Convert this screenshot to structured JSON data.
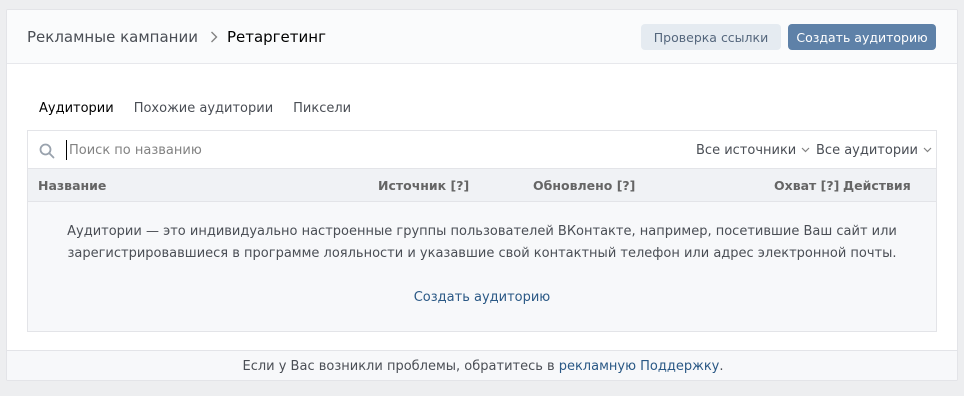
{
  "header": {
    "breadcrumb_root": "Рекламные кампании",
    "breadcrumb_current": "Ретаргетинг",
    "check_link_label": "Проверка ссылки",
    "create_audience_label": "Создать аудиторию"
  },
  "tabs": [
    {
      "label": "Аудитории",
      "active": true
    },
    {
      "label": "Похожие аудитории",
      "active": false
    },
    {
      "label": "Пиксели",
      "active": false
    }
  ],
  "search": {
    "placeholder": "Поиск по названию",
    "value": ""
  },
  "filters": {
    "sources": "Все источники",
    "audiences": "Все аудитории"
  },
  "table": {
    "columns": [
      "Название",
      "Источник [?]",
      "Обновлено [?]",
      "Охват [?]",
      "Действия"
    ]
  },
  "empty_state": {
    "line1": "Аудитории — это индивидуально настроенные группы пользователей ВКонтакте, например, посетившие Ваш сайт или",
    "line2": "зарегистрировавшиеся в программе лояльности и указавшие свой контактный телефон или адрес электронной почты.",
    "create_link": "Создать аудиторию"
  },
  "footer": {
    "text": "Если у Вас возникли проблемы, обратитесь в",
    "link": "рекламную Поддержку",
    "end": "."
  },
  "colors": {
    "accent": "#5e81a8",
    "link": "#2a5885",
    "background": "#edeef0"
  }
}
